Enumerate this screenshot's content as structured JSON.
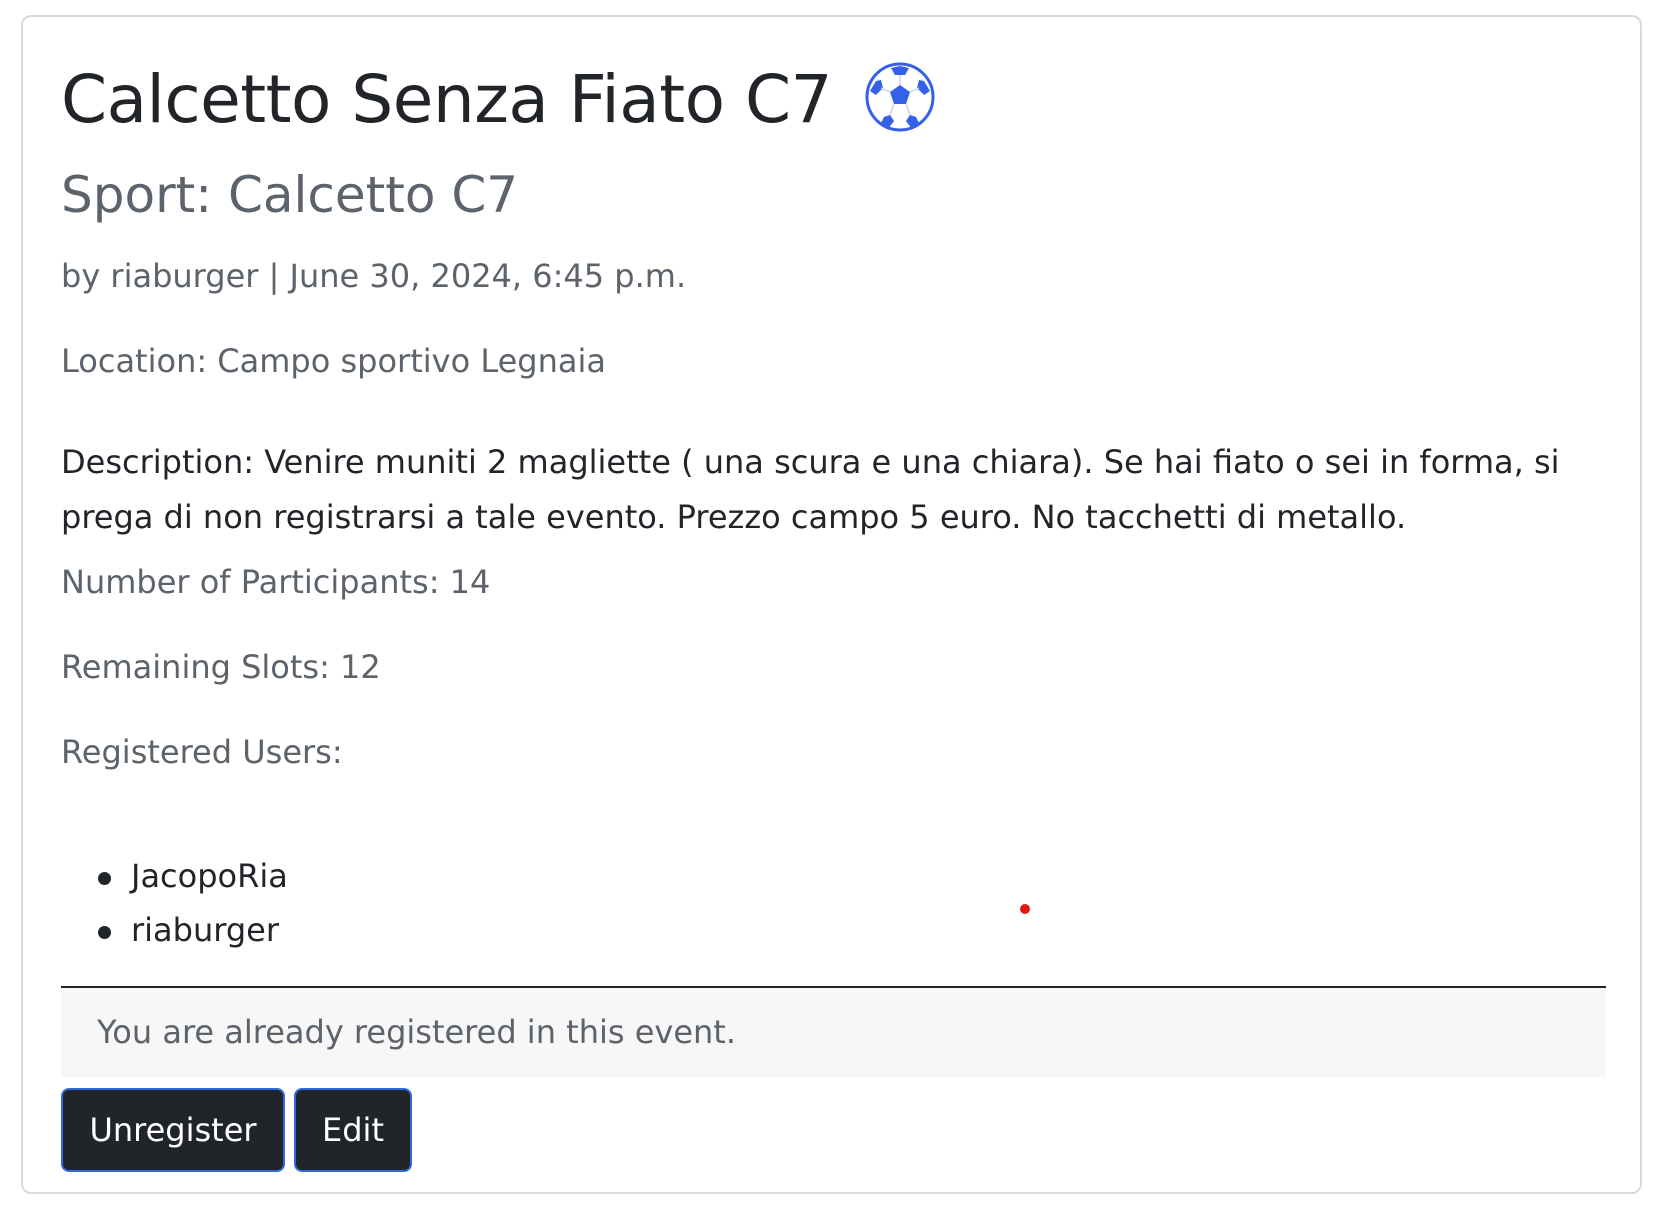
{
  "event": {
    "title": "Calcetto Senza Fiato C7",
    "title_icon": "soccer-ball-icon",
    "sport": "Sport: Calcetto C7",
    "meta": "by riaburger | June 30, 2024, 6:45 p.m.",
    "location": "Location: Campo sportivo Legnaia",
    "description": "Description: Venire muniti 2 magliette ( una scura e una chiara). Se hai fiato o sei in forma, si prega di non registrarsi a tale evento. Prezzo campo 5 euro. No tacchetti di metallo.",
    "participants": "Number of Participants: 14",
    "remaining": "Remaining Slots: 12",
    "registered_label": "Registered Users:",
    "registered_users": [
      "JacopoRia",
      "riaburger"
    ]
  },
  "status": {
    "notice": "You are already registered in this event."
  },
  "actions": {
    "unregister_label": "Unregister",
    "edit_label": "Edit"
  },
  "colors": {
    "button_bg": "#212529",
    "button_border": "#2f6cd9",
    "ball_blue": "#3560e8"
  }
}
